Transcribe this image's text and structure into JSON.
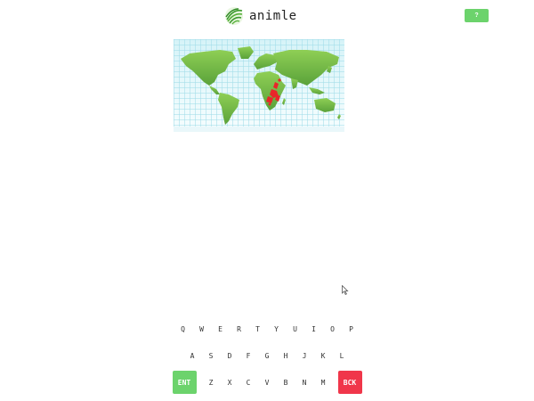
{
  "header": {
    "logo_icon": "palm-leaf-icon",
    "title": "animle",
    "help_label": "?",
    "help_color": "#6cd36c"
  },
  "map": {
    "land_color": "#7cc04a",
    "range_color": "#e8262a",
    "highlighted_region": "southern-central Africa"
  },
  "keyboard": {
    "rows": [
      [
        "Q",
        "W",
        "E",
        "R",
        "T",
        "Y",
        "U",
        "I",
        "O",
        "P"
      ],
      [
        "A",
        "S",
        "D",
        "F",
        "G",
        "H",
        "J",
        "K",
        "L"
      ],
      [
        "Z",
        "X",
        "C",
        "V",
        "B",
        "N",
        "M"
      ]
    ],
    "enter_label": "ENT",
    "back_label": "BCK",
    "enter_color": "#6cd36c",
    "back_color": "#f0364a"
  }
}
